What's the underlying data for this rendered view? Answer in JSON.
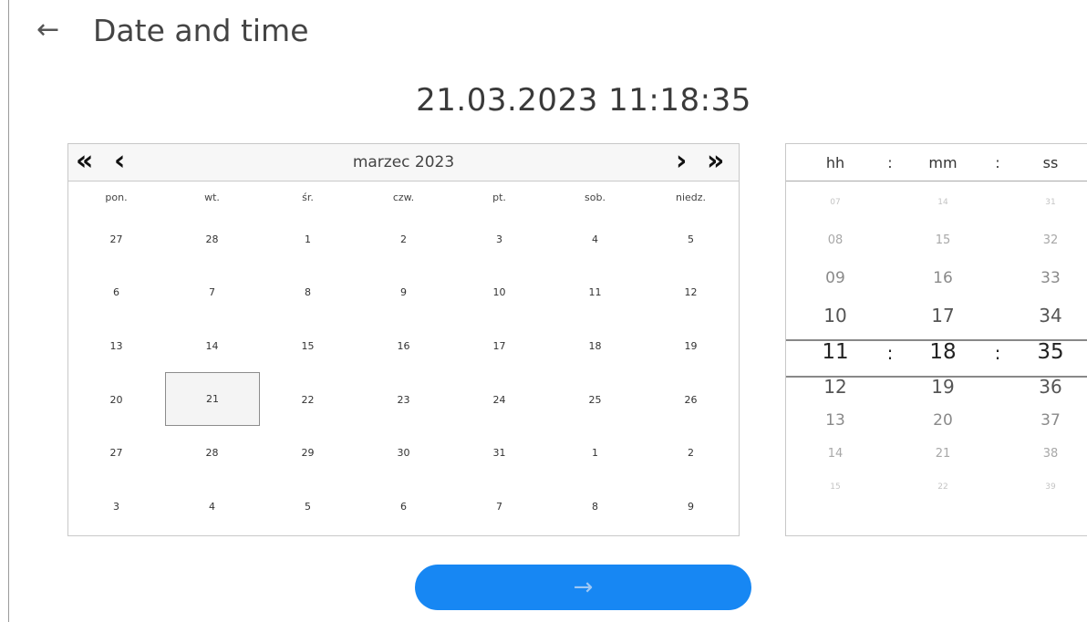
{
  "header": {
    "back_icon": "arrow-left-icon",
    "title": "Date and time"
  },
  "current_datetime": "21.03.2023 11:18:35",
  "calendar": {
    "month_label": "marzec 2023",
    "nav": {
      "prev_year": "«",
      "prev_month": "‹",
      "next_month": "›",
      "next_year": "»"
    },
    "weekdays": [
      "pon.",
      "wt.",
      "śr.",
      "czw.",
      "pt.",
      "sob.",
      "niedz."
    ],
    "days": [
      "27",
      "28",
      "1",
      "2",
      "3",
      "4",
      "5",
      "6",
      "7",
      "8",
      "9",
      "10",
      "11",
      "12",
      "13",
      "14",
      "15",
      "16",
      "17",
      "18",
      "19",
      "20",
      "21",
      "22",
      "23",
      "24",
      "25",
      "26",
      "27",
      "28",
      "29",
      "30",
      "31",
      "1",
      "2",
      "3",
      "4",
      "5",
      "6",
      "7",
      "8",
      "9"
    ],
    "selected_day": "21"
  },
  "time": {
    "headers": {
      "hh": "hh",
      "mm": "mm",
      "ss": "ss",
      "sep": ":"
    },
    "hours": [
      "07",
      "08",
      "09",
      "10",
      "11",
      "12",
      "13",
      "14",
      "15"
    ],
    "minutes": [
      "14",
      "15",
      "16",
      "17",
      "18",
      "19",
      "20",
      "21",
      "22"
    ],
    "seconds": [
      "31",
      "32",
      "33",
      "34",
      "35",
      "36",
      "37",
      "38",
      "39"
    ],
    "selected_index": 4
  },
  "confirm_button": {
    "label": "→",
    "icon": "arrow-right-icon",
    "color": "#1787f3"
  }
}
